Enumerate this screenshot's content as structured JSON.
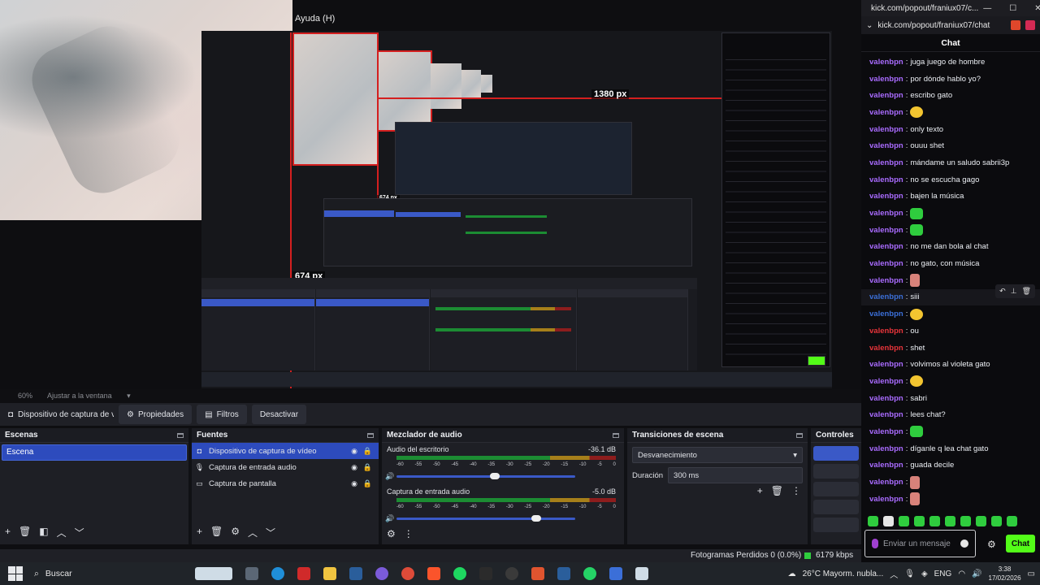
{
  "window": {
    "help_menu": "Ayuda (H)"
  },
  "preview": {
    "px_label_main": "1380 px",
    "px_label_small": "674 px",
    "px_label_left": "674 px"
  },
  "obs": {
    "zoom": "60%",
    "fit": "Ajustar a la ventana",
    "source_selected": "Dispositivo de captura de v",
    "toolbar": {
      "properties": "Propiedades",
      "filters": "Filtros",
      "deactivate": "Desactivar"
    },
    "scenes": {
      "title": "Escenas",
      "items": [
        "Escena"
      ]
    },
    "sources": {
      "title": "Fuentes",
      "items": [
        {
          "label": "Dispositivo de captura de vídeo",
          "icon": "camera-icon"
        },
        {
          "label": "Captura de entrada audio",
          "icon": "microphone-icon"
        },
        {
          "label": "Captura de pantalla",
          "icon": "monitor-icon"
        }
      ]
    },
    "mixer": {
      "title": "Mezclador de audio",
      "channels": [
        {
          "name": "Audio del escritorio",
          "db": "-36.1 dB",
          "volume_pct": 55
        },
        {
          "name": "Captura de entrada audio",
          "db": "-5.0 dB",
          "volume_pct": 78
        }
      ],
      "ticks": [
        "-60",
        "-55",
        "-50",
        "-45",
        "-40",
        "-35",
        "-30",
        "-25",
        "-20",
        "-15",
        "-10",
        "-5",
        "0"
      ]
    },
    "transitions": {
      "title": "Transiciones de escena",
      "selected": "Desvanecimiento",
      "duration_label": "Duración",
      "duration": "300 ms"
    },
    "controls": {
      "title": "Controles"
    },
    "status": {
      "dropped": "Fotogramas Perdidos 0 (0.0%)",
      "bitrate": "6179 kbps"
    }
  },
  "chat": {
    "window_title": "kick.com/popout/franiux07/c...",
    "url": "kick.com/popout/franiux07/chat",
    "header": "Chat",
    "messages": [
      {
        "user": "valenbpn",
        "text": "juga juego de hombre",
        "color": "#a96bff"
      },
      {
        "user": "valenbpn",
        "text": "por dónde hablo yo?",
        "color": "#a96bff"
      },
      {
        "user": "valenbpn",
        "text": "escribo gato",
        "color": "#a96bff"
      },
      {
        "user": "valenbpn",
        "text": "",
        "color": "#a96bff",
        "emote": "y"
      },
      {
        "user": "valenbpn",
        "text": "only texto",
        "color": "#a96bff"
      },
      {
        "user": "valenbpn",
        "text": "ouuu shet",
        "color": "#a96bff"
      },
      {
        "user": "valenbpn",
        "text": "mándame un saludo sabrii3p",
        "color": "#a96bff"
      },
      {
        "user": "valenbpn",
        "text": "no se escucha gago",
        "color": "#a96bff"
      },
      {
        "user": "valenbpn",
        "text": "bajen la música",
        "color": "#a96bff"
      },
      {
        "user": "valenbpn",
        "text": "",
        "color": "#a96bff",
        "emote": "g"
      },
      {
        "user": "valenbpn",
        "text": "",
        "color": "#a96bff",
        "emote": "g"
      },
      {
        "user": "valenbpn",
        "text": "no me dan bola al chat",
        "color": "#a96bff"
      },
      {
        "user": "valenbpn",
        "text": "no gato, con música",
        "color": "#a96bff"
      },
      {
        "user": "valenbpn",
        "text": "",
        "color": "#a96bff",
        "emote": "h"
      },
      {
        "user": "valenbpn",
        "text": "siii",
        "color": "#3b6fd8"
      },
      {
        "user": "valenbpn",
        "text": "",
        "color": "#3b6fd8",
        "emote": "y"
      },
      {
        "user": "valenbpn",
        "text": "ou",
        "color": "#e8343a"
      },
      {
        "user": "valenbpn",
        "text": "shet",
        "color": "#e8343a"
      },
      {
        "user": "valenbpn",
        "text": "volvimos al violeta gato",
        "color": "#a96bff"
      },
      {
        "user": "valenbpn",
        "text": "",
        "color": "#a96bff",
        "emote": "y"
      },
      {
        "user": "valenbpn",
        "text": "sabri",
        "color": "#a96bff"
      },
      {
        "user": "valenbpn",
        "text": "lees chat?",
        "color": "#a96bff"
      },
      {
        "user": "valenbpn",
        "text": "",
        "color": "#a96bff",
        "emote": "g"
      },
      {
        "user": "valenbpn",
        "text": "díganle q lea chat gato",
        "color": "#a96bff"
      },
      {
        "user": "valenbpn",
        "text": "guada decile",
        "color": "#a96bff"
      },
      {
        "user": "valenbpn",
        "text": "",
        "color": "#a96bff",
        "emote": "h"
      },
      {
        "user": "valenbpn",
        "text": "",
        "color": "#a96bff",
        "emote": "h"
      }
    ],
    "input_placeholder": "Enviar un mensaje",
    "send_label": "Chat",
    "accent": "#53fc18"
  },
  "taskbar": {
    "search": "Buscar",
    "weather": "26°C  Mayorm. nubla...",
    "lang": "ENG",
    "time": "3:38",
    "date": "17/02/2026"
  }
}
